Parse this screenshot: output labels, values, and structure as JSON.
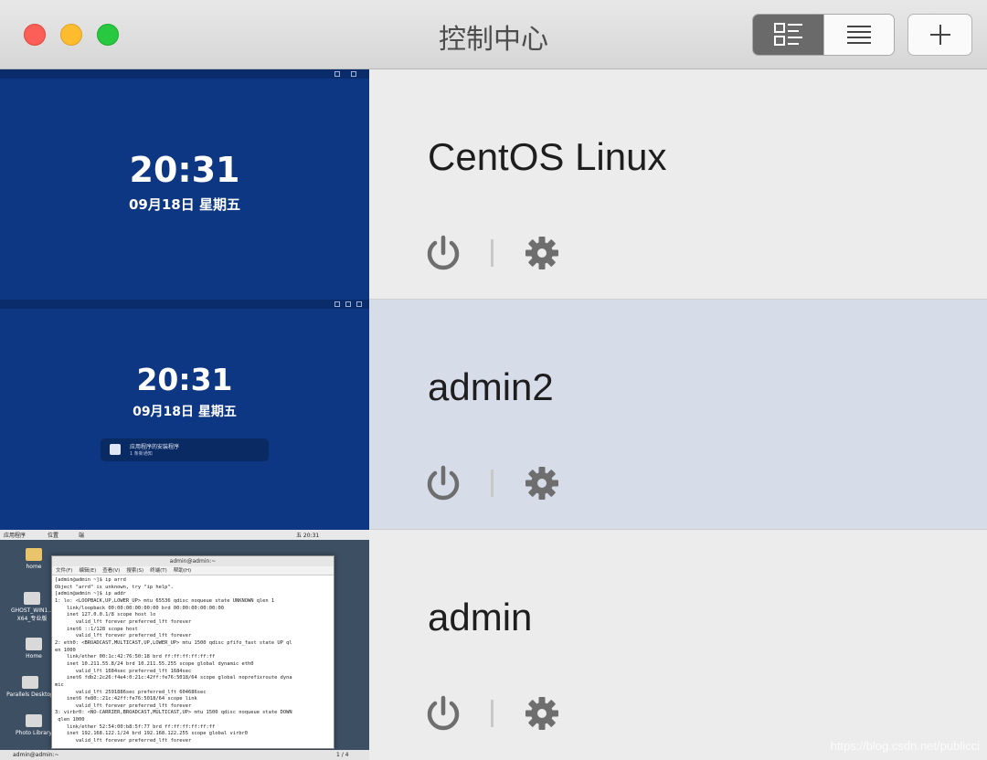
{
  "window": {
    "title": "控制中心"
  },
  "toolbar": {
    "view_mode": "detail"
  },
  "vms": [
    {
      "name": "CentOS Linux",
      "selected": false,
      "screen": {
        "kind": "lock",
        "time": "20:31",
        "date": "09月18日 星期五"
      }
    },
    {
      "name": "admin2",
      "selected": true,
      "screen": {
        "kind": "lock",
        "time": "20:31",
        "date": "09月18日 星期五",
        "notification": {
          "title": "应用程序的安装程序",
          "subtitle": "1 条新通知"
        }
      }
    },
    {
      "name": "admin",
      "selected": false,
      "screen": {
        "kind": "desktop",
        "panel_menus": [
          "应用程序",
          "位置",
          "端"
        ],
        "panel_clock": "五 20:31",
        "desktop_icons": [
          "home",
          "GHOST_WIN1... X64_专业版",
          "Home",
          "Parallels Desktop",
          "Photo Library"
        ],
        "terminal": {
          "title": "admin@admin:~",
          "menu": [
            "文件(F)",
            "编辑(E)",
            "查看(V)",
            "搜索(S)",
            "终端(T)",
            "帮助(H)"
          ],
          "lines": [
            "[admin@admin ~]$ ip arrd",
            "Object \"arrd\" is unknown, try \"ip help\".",
            "[admin@admin ~]$ ip addr",
            "1: lo: <LOOPBACK,UP,LOWER_UP> mtu 65536 qdisc noqueue state UNKNOWN qlen 1",
            "    link/loopback 00:00:00:00:00:00 brd 00:00:00:00:00:00",
            "    inet 127.0.0.1/8 scope host lo",
            "       valid_lft forever preferred_lft forever",
            "    inet6 ::1/128 scope host",
            "       valid_lft forever preferred_lft forever",
            "2: eth0: <BROADCAST,MULTICAST,UP,LOWER_UP> mtu 1500 qdisc pfifo_fast state UP ql",
            "en 1000",
            "    link/ether 00:1c:42:76:50:18 brd ff:ff:ff:ff:ff:ff",
            "    inet 10.211.55.8/24 brd 10.211.55.255 scope global dynamic eth0",
            "       valid_lft 1684sec preferred_lft 1684sec",
            "    inet6 fdb2:2c26:f4e4:0:21c:42ff:fe76:5018/64 scope global noprefixroute dyna",
            "mic",
            "       valid_lft 2591886sec preferred_lft 604686sec",
            "    inet6 fe80::21c:42ff:fe76:5018/64 scope link",
            "       valid_lft forever preferred_lft forever",
            "3: virbr0: <NO-CARRIER,BROADCAST,MULTICAST,UP> mtu 1500 qdisc noqueue state DOWN",
            " qlen 1000",
            "    link/ether 52:54:00:b8:5f:77 brd ff:ff:ff:ff:ff:ff",
            "    inet 192.168.122.1/24 brd 192.168.122.255 scope global virbr0",
            "       valid_lft forever preferred_lft forever"
          ]
        },
        "taskbar_item": "admin@admin:~",
        "workspace": "1 / 4"
      }
    }
  ],
  "watermark": "https://blog.csdn.net/publicci"
}
